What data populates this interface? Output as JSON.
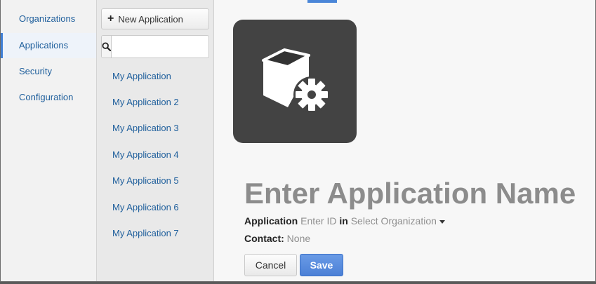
{
  "nav": {
    "items": [
      {
        "label": "Organizations",
        "active": false
      },
      {
        "label": "Applications",
        "active": true
      },
      {
        "label": "Security",
        "active": false
      },
      {
        "label": "Configuration",
        "active": false
      }
    ]
  },
  "apps_panel": {
    "new_button_label": "New Application",
    "search": {
      "placeholder": "",
      "value": ""
    },
    "items": [
      "My Application",
      "My Application 2",
      "My Application 3",
      "My Application 4",
      "My Application 5",
      "My Application 6",
      "My Application 7"
    ]
  },
  "detail": {
    "icon": "application-gear-icon",
    "name_placeholder": "Enter Application Name",
    "application_label": "Application",
    "id_placeholder": "Enter ID",
    "in_label": "in",
    "organization_select": "Select Organization",
    "contact_label": "Contact:",
    "contact_value": "None",
    "cancel_label": "Cancel",
    "save_label": "Save"
  },
  "colors": {
    "link": "#1f5f9c",
    "accent": "#4a86d8",
    "tile": "#434343",
    "muted": "#8f8f8f"
  }
}
